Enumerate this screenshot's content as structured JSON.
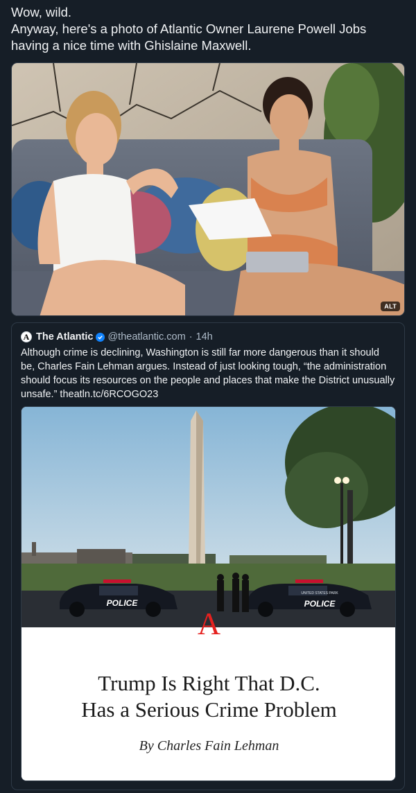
{
  "post": {
    "lines": [
      "Wow, wild.",
      "Anyway, here's a photo of Atlantic Owner Laurene Powell Jobs having a nice time with Ghislaine Maxwell."
    ]
  },
  "photo": {
    "alt_badge": "ALT"
  },
  "quote": {
    "avatar_letter": "A",
    "name": "The Atlantic",
    "handle": "@theatlantic.com",
    "separator": "·",
    "time": "14h",
    "text": "Although crime is declining, Washington is still far more dangerous than it should be, Charles Fain Lehman argues. Instead of just looking tough, “the administration should focus its resources on the people and places that make the District unusually unsafe.” theatln.tc/6RCOGO23"
  },
  "link_card": {
    "police_label": "POLICE",
    "police_label_2": "POLICE",
    "car_sub_label": "UNITED STATES PARK",
    "logo": "A",
    "headline_line1": "Trump Is Right That D.C.",
    "headline_line2": "Has a Serious Crime Problem",
    "byline": "By Charles Fain Lehman"
  },
  "colors": {
    "background": "#161e27",
    "border": "#2e3a47",
    "verified": "#1083fe",
    "atlantic_red": "#e5211f"
  }
}
